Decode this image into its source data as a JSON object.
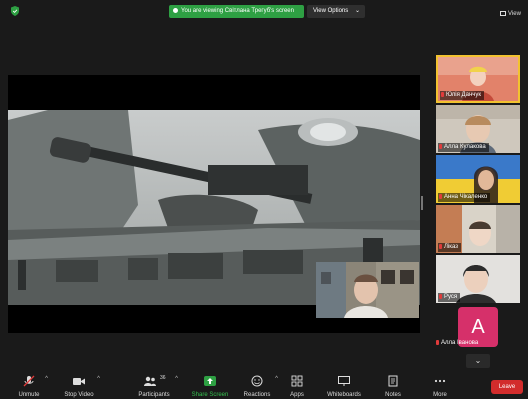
{
  "topbar": {
    "banner_text": "You are viewing Світлана Трегуб's screen",
    "view_options_label": "View Options",
    "view_options_chevron": "⌄",
    "view_label": "View",
    "shield_color": "#2ea043"
  },
  "participants": [
    {
      "name": "Юлія Данчук",
      "active": true
    },
    {
      "name": "Алла Кулакова",
      "active": false
    },
    {
      "name": "Анна Чікаленко",
      "active": false
    },
    {
      "name": "Ліказ",
      "active": false
    },
    {
      "name": "Руся",
      "active": false
    }
  ],
  "avatar_tile": {
    "letter": "A",
    "name": "Алла Іванова",
    "color": "#d6306a"
  },
  "more_tiles_icon": "⌄",
  "toolbar": {
    "unmute": "Unmute",
    "stop_video": "Stop Video",
    "participants": "Participants",
    "participants_count": "36",
    "share_screen": "Share Screen",
    "reactions": "Reactions",
    "apps": "Apps",
    "whiteboards": "Whiteboards",
    "notes": "Notes",
    "more": "More",
    "leave": "Leave",
    "caret": "^"
  },
  "colors": {
    "leave": "#d22c2c",
    "share_green": "#2ea043",
    "active_border": "#f2c230",
    "muted_red": "#e03b3b"
  }
}
